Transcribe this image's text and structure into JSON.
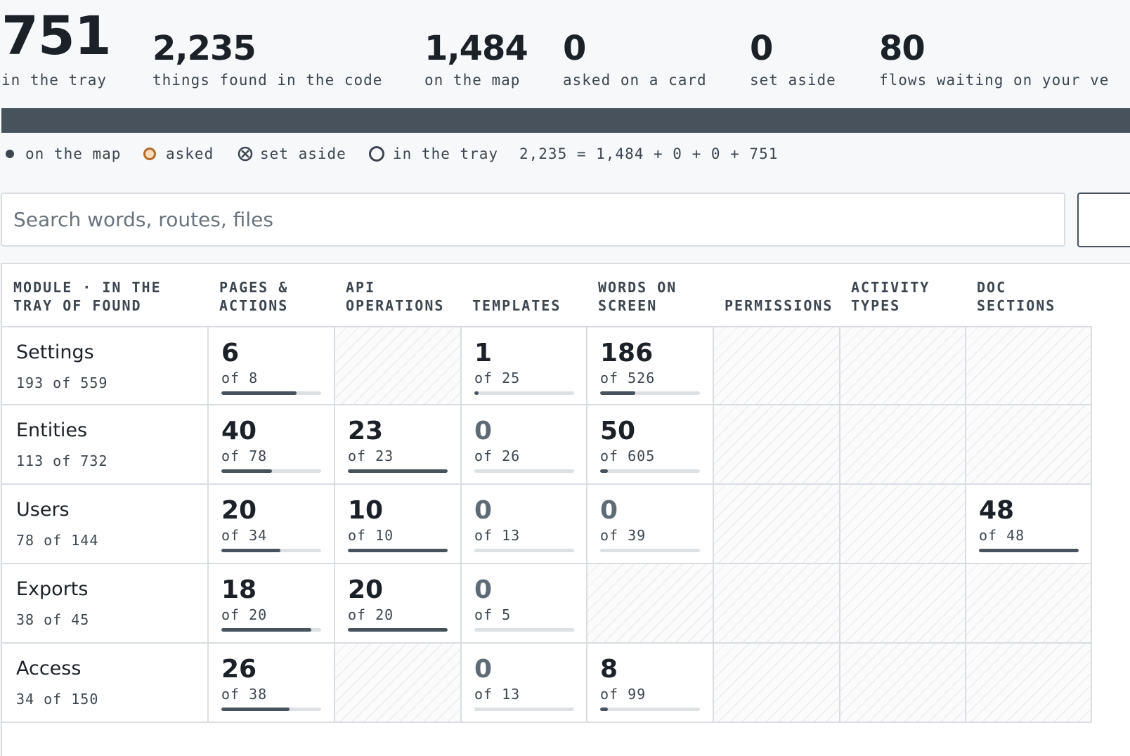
{
  "stats": [
    {
      "value": "751",
      "label": "in the tray"
    },
    {
      "value": "2,235",
      "label": "things found in the code"
    },
    {
      "value": "1,484",
      "label": "on the map"
    },
    {
      "value": "0",
      "label": "asked on a card"
    },
    {
      "value": "0",
      "label": "set aside"
    },
    {
      "value": "80",
      "label": "flows waiting on your ve"
    }
  ],
  "legend": {
    "on_map": "on the map",
    "asked": "asked",
    "set_aside": "set aside",
    "in_tray": "in the tray",
    "equation": "2,235 = 1,484 + 0 + 0 + 751"
  },
  "search": {
    "placeholder": "Search words, routes, files"
  },
  "table": {
    "headers": [
      {
        "line1": "MODULE · IN THE",
        "line2": "TRAY OF FOUND"
      },
      {
        "line1": "PAGES &",
        "line2": "ACTIONS"
      },
      {
        "line1": "API",
        "line2": "OPERATIONS"
      },
      {
        "line1": "",
        "line2": "TEMPLATES"
      },
      {
        "line1": "WORDS ON",
        "line2": "SCREEN"
      },
      {
        "line1": "",
        "line2": "PERMISSIONS"
      },
      {
        "line1": "ACTIVITY",
        "line2": "TYPES"
      },
      {
        "line1": "DOC",
        "line2": "SECTIONS"
      }
    ],
    "rows": [
      {
        "name": "Settings",
        "sub": "193 of 559",
        "cells": [
          {
            "value": "6",
            "of": "of 8",
            "progress": 0.75
          },
          null,
          {
            "value": "1",
            "of": "of 25",
            "progress": 0.04
          },
          {
            "value": "186",
            "of": "of 526",
            "progress": 0.35
          },
          null,
          null,
          null
        ]
      },
      {
        "name": "Entities",
        "sub": "113 of 732",
        "cells": [
          {
            "value": "40",
            "of": "of 78",
            "progress": 0.51
          },
          {
            "value": "23",
            "of": "of 23",
            "progress": 1.0
          },
          {
            "value": "0",
            "of": "of 26",
            "progress": 0
          },
          {
            "value": "50",
            "of": "of 605",
            "progress": 0.08
          },
          null,
          null,
          null
        ]
      },
      {
        "name": "Users",
        "sub": "78 of 144",
        "cells": [
          {
            "value": "20",
            "of": "of 34",
            "progress": 0.59
          },
          {
            "value": "10",
            "of": "of 10",
            "progress": 1.0
          },
          {
            "value": "0",
            "of": "of 13",
            "progress": 0
          },
          {
            "value": "0",
            "of": "of 39",
            "progress": 0
          },
          null,
          null,
          {
            "value": "48",
            "of": "of 48",
            "progress": 1.0
          }
        ]
      },
      {
        "name": "Exports",
        "sub": "38 of 45",
        "cells": [
          {
            "value": "18",
            "of": "of 20",
            "progress": 0.9
          },
          {
            "value": "20",
            "of": "of 20",
            "progress": 1.0
          },
          {
            "value": "0",
            "of": "of 5",
            "progress": 0
          },
          null,
          null,
          null,
          null
        ]
      },
      {
        "name": "Access",
        "sub": "34 of 150",
        "cells": [
          {
            "value": "26",
            "of": "of 38",
            "progress": 0.68
          },
          null,
          {
            "value": "0",
            "of": "of 13",
            "progress": 0
          },
          {
            "value": "8",
            "of": "of 99",
            "progress": 0.08
          },
          null,
          null,
          null
        ]
      }
    ]
  },
  "colors": {
    "accent": "#47525d",
    "asked": "#b56a26",
    "border": "#d9dde2"
  }
}
